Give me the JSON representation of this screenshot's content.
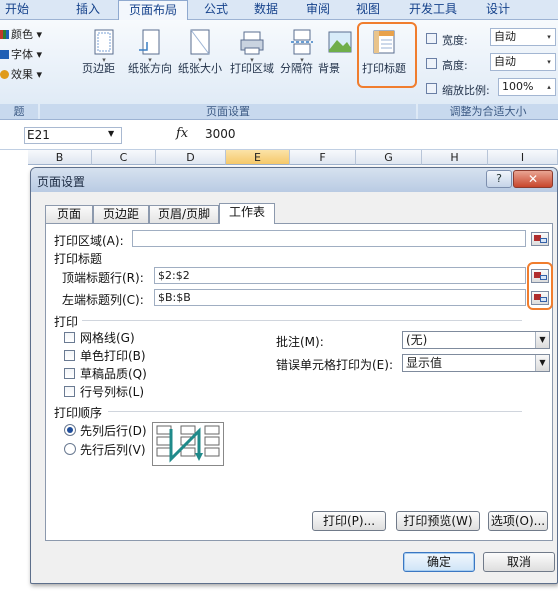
{
  "ribbon": {
    "tabs": [
      "开始",
      "插入",
      "页面布局",
      "公式",
      "数据",
      "审阅",
      "视图",
      "开发工具",
      "设计"
    ],
    "active_tab": "页面布局",
    "theme_items": [
      "颜色",
      "字体",
      "效果"
    ],
    "buttons": [
      "页边距",
      "纸张方向",
      "纸张大小",
      "打印区域",
      "分隔符",
      "背景",
      "打印标题"
    ],
    "scale": {
      "width_label": "宽度:",
      "width_value": "自动",
      "height_label": "高度:",
      "height_value": "自动",
      "scale_label": "缩放比例:",
      "scale_value": "100%"
    },
    "group_labels": [
      "题",
      "页面设置",
      "调整为合适大小"
    ]
  },
  "formula_bar": {
    "name_box": "E21",
    "fx": "fx",
    "value": "3000"
  },
  "columns": [
    "B",
    "C",
    "D",
    "E",
    "F",
    "G",
    "H",
    "I"
  ],
  "dialog": {
    "title": "页面设置",
    "help_glyph": "?",
    "close_glyph": "✕",
    "tabs": [
      "页面",
      "页边距",
      "页眉/页脚",
      "工作表"
    ],
    "active_tab": "工作表",
    "print_area_label": "打印区域(A):",
    "print_area_value": "",
    "print_titles_label": "打印标题",
    "top_rows_label": "顶端标题行(R):",
    "top_rows_value": "$2:$2",
    "left_cols_label": "左端标题列(C):",
    "left_cols_value": "$B:$B",
    "print_section_label": "打印",
    "checkboxes": [
      "网格线(G)",
      "单色打印(B)",
      "草稿品质(Q)",
      "行号列标(L)"
    ],
    "comments_label": "批注(M):",
    "comments_value": "(无)",
    "errors_label": "错误单元格打印为(E):",
    "errors_value": "显示值",
    "order_label": "打印顺序",
    "order_options": [
      "先列后行(D)",
      "先行后列(V)"
    ],
    "order_selected": "先列后行(D)",
    "print_button": "打印(P)...",
    "preview_button": "打印预览(W)",
    "options_button": "选项(O)...",
    "ok_button": "确定",
    "cancel_button": "取消"
  },
  "colors": {
    "highlight": "#f07d2e",
    "ribbon_bg": "#dce8f5",
    "selected_column": "#f5c86a"
  }
}
